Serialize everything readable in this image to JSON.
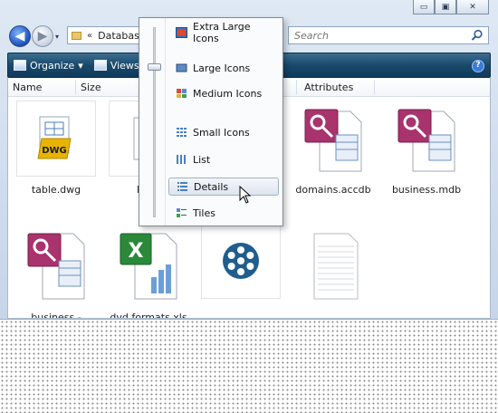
{
  "window": {
    "caption_buttons": [
      {
        "name": "minimize-button",
        "glyph": "▭"
      },
      {
        "name": "maximize-button",
        "glyph": "▣"
      },
      {
        "name": "close-button",
        "glyph": "✕"
      }
    ]
  },
  "address": {
    "chevron": "«",
    "path": "Database"
  },
  "search": {
    "placeholder": "Search"
  },
  "commandbar": {
    "organize": "Organize",
    "views": "Views",
    "dropdown_glyph": "▾",
    "help_glyph": "?"
  },
  "columns": [
    "Name",
    "Size",
    "Attributes"
  ],
  "files": [
    {
      "name": "table.dwg",
      "icon": "dwg-icon"
    },
    {
      "name": "Bosc",
      "icon": "document-icon"
    },
    {
      "name": "domains.accdb",
      "icon": "access-icon"
    },
    {
      "name": "business.mdb",
      "icon": "access-icon"
    },
    {
      "name": "business -",
      "icon": "access-icon"
    },
    {
      "name": "dvd formats.xls",
      "icon": "excel-icon"
    },
    {
      "name": "",
      "icon": "snowflake-icon"
    },
    {
      "name": "",
      "icon": "blank-document-icon"
    }
  ],
  "views_menu": {
    "items": [
      {
        "label": "Extra Large Icons"
      },
      {
        "label": "Large Icons"
      },
      {
        "label": "Medium Icons"
      },
      {
        "label": "Small Icons"
      },
      {
        "label": "List"
      },
      {
        "label": "Details",
        "selected": true
      },
      {
        "label": "Tiles"
      }
    ]
  },
  "colors": {
    "cmdbar": "#19496b",
    "access": "#a8336d",
    "excel": "#2a8a3a",
    "snowflake": "#1f5e8e",
    "dwg_badge": "#e8b400"
  }
}
